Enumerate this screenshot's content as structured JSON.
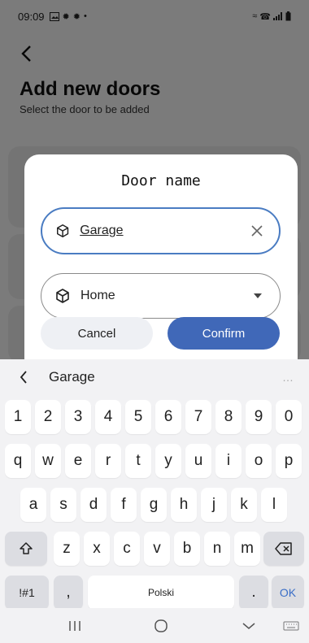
{
  "status_bar": {
    "time": "09:09",
    "left_icons": [
      "gallery-icon",
      "gear-icon",
      "gear-icon",
      "dot-icon"
    ],
    "right_icons": [
      "wifi-icon",
      "call-icon",
      "signal-icon",
      "battery-icon"
    ]
  },
  "page": {
    "title": "Add new doors",
    "subtitle": "Select the door to be added"
  },
  "dialog": {
    "title": "Door name",
    "name_field": {
      "value": "Garage",
      "icon": "cube-icon"
    },
    "location_select": {
      "value": "Home",
      "icon": "cube-icon"
    },
    "cancel_label": "Cancel",
    "confirm_label": "Confirm",
    "accent_color": "#4068b8"
  },
  "keyboard": {
    "suggestion": "Garage",
    "more": "…",
    "row_numbers": [
      "1",
      "2",
      "3",
      "4",
      "5",
      "6",
      "7",
      "8",
      "9",
      "0"
    ],
    "row_q": [
      "q",
      "w",
      "e",
      "r",
      "t",
      "y",
      "u",
      "i",
      "o",
      "p"
    ],
    "row_a": [
      "a",
      "s",
      "d",
      "f",
      "g",
      "h",
      "j",
      "k",
      "l"
    ],
    "row_z": [
      "z",
      "x",
      "c",
      "v",
      "b",
      "n",
      "m"
    ],
    "symbols_label": "!#1",
    "comma_label": ",",
    "space_label": "Polski",
    "period_label": ".",
    "ok_label": "OK"
  }
}
